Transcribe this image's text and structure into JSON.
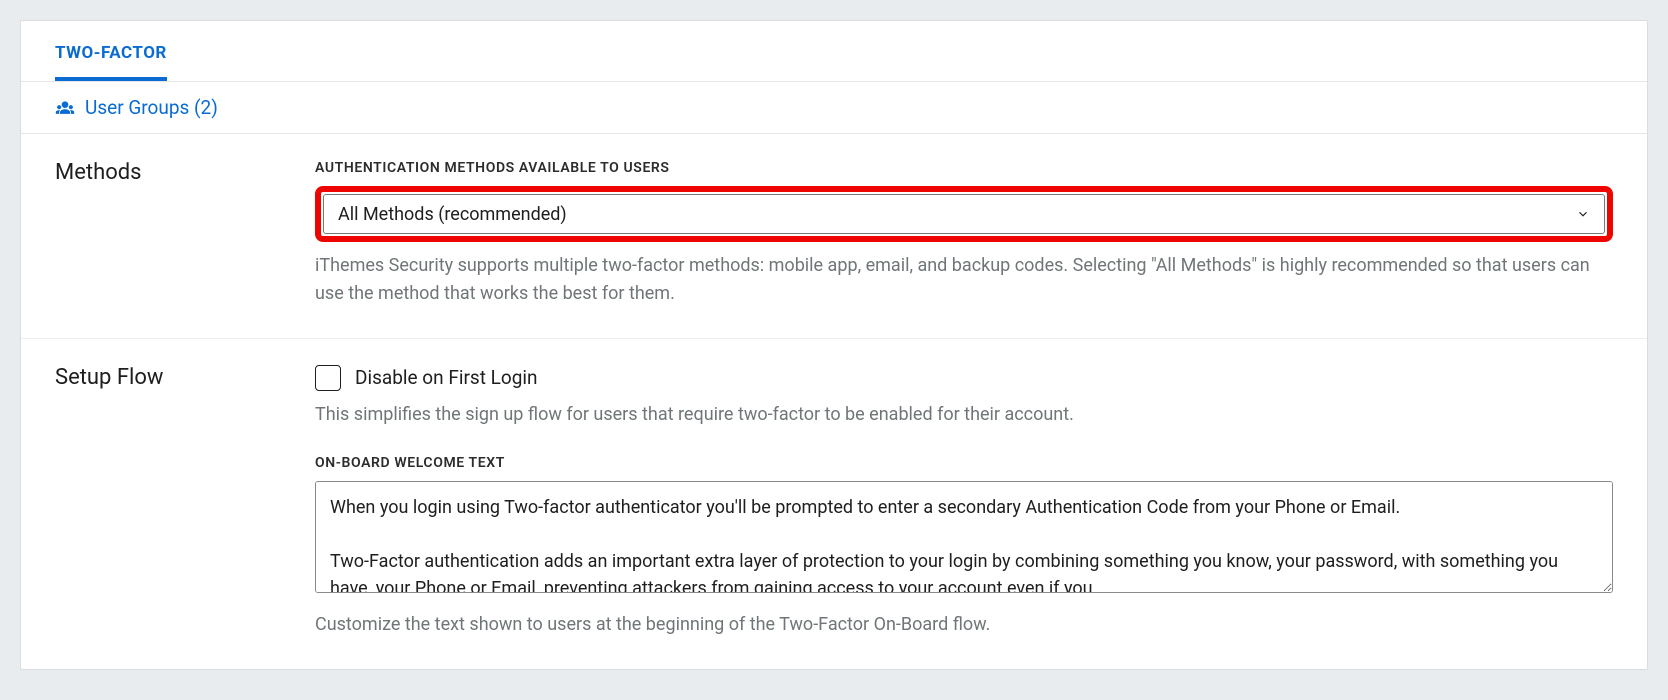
{
  "tabs": {
    "active": "TWO-FACTOR"
  },
  "user_groups": {
    "label": "User Groups (2)"
  },
  "sections": {
    "methods": {
      "heading": "Methods",
      "field_label": "AUTHENTICATION METHODS AVAILABLE TO USERS",
      "select_value": "All Methods (recommended)",
      "help": "iThemes Security supports multiple two-factor methods: mobile app, email, and backup codes. Selecting \"All Methods\" is highly recommended so that users can use the method that works the best for them."
    },
    "setup_flow": {
      "heading": "Setup Flow",
      "checkbox_label": "Disable on First Login",
      "checkbox_help": "This simplifies the sign up flow for users that require two-factor to be enabled for their account.",
      "onboard_label": "ON-BOARD WELCOME TEXT",
      "onboard_value": "When you login using Two-factor authenticator you'll be prompted to enter a secondary Authentication Code from your Phone or Email.\n\nTwo-Factor authentication adds an important extra layer of protection to your login by combining something you know, your password, with something you have, your Phone or Email, preventing attackers from gaining access to your account even if you",
      "onboard_help": "Customize the text shown to users at the beginning of the Two-Factor On-Board flow."
    }
  }
}
